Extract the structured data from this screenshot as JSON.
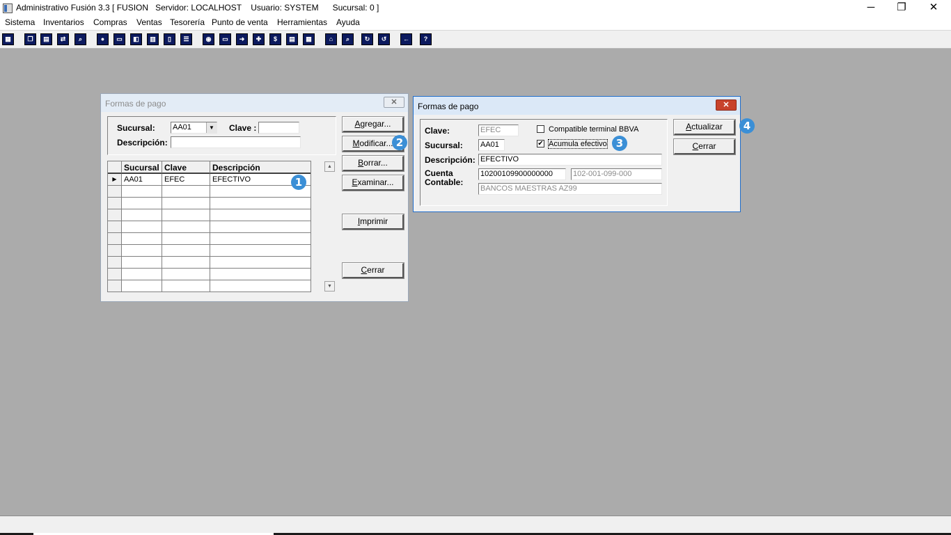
{
  "window": {
    "title": "Administrativo Fusión 3.3 [ FUSION   Servidor: LOCALHOST    Usuario: SYSTEM      Sucursal: 0 ]",
    "minimize_icon": "minimize-icon",
    "restore_icon": "restore-icon",
    "close_icon": "close-icon"
  },
  "menu": [
    "Sistema",
    "Inventarios",
    "Compras",
    "Ventas",
    "Tesorería",
    "Punto de venta",
    "Herramientas",
    "Ayuda"
  ],
  "toolbar": {
    "icons": [
      "calculator-icon",
      "copy-icon",
      "paste-icon",
      "swap-icon",
      "search-doc-icon",
      "user-icon",
      "folder-icon",
      "print-left-icon",
      "print-icon",
      "document-icon",
      "list-icon",
      "binoculars-icon",
      "folder-open-icon",
      "export-icon",
      "add-icon",
      "money-icon",
      "report-icon",
      "table-icon",
      "home-icon",
      "zoom-icon",
      "refresh-icon",
      "undo-icon",
      "back-arrow-icon",
      "help-icon"
    ],
    "help_glyph": "?"
  },
  "dialog_list": {
    "title": "Formas de pago",
    "close_glyph": "✕",
    "sucursal_label": "Sucursal:",
    "sucursal_value": "AA01",
    "clave_label": "Clave :",
    "clave_value": "",
    "descripcion_label": "Descripción:",
    "descripcion_value": "",
    "columns": [
      "Sucursal",
      "Clave",
      "Descripción"
    ],
    "rows": [
      {
        "sucursal": "AA01",
        "clave": "EFEC",
        "descripcion": "EFECTIVO"
      }
    ],
    "buttons": {
      "agregar": "Agregar...",
      "modificar": "Modificar...",
      "borrar": "Borrar...",
      "examinar": "Examinar...",
      "imprimir": "Imprimir",
      "cerrar": "Cerrar"
    }
  },
  "dialog_edit": {
    "title": "Formas de pago",
    "close_glyph": "✕",
    "clave_label": "Clave:",
    "clave_value": "EFEC",
    "sucursal_label": "Sucursal:",
    "sucursal_value": "AA01",
    "descripcion_label": "Descripción:",
    "descripcion_value": "EFECTIVO",
    "cuenta_label_1": "Cuenta",
    "cuenta_label_2": "Contable:",
    "cuenta_value": "10200109900000000",
    "cuenta_format": "102-001-099-000",
    "cuenta_nombre": "BANCOS MAESTRAS AZ99",
    "compatible_bbva_label": "Compatible terminal BBVA",
    "compatible_bbva_checked": false,
    "acumula_efectivo_label": "Acumula efectivo",
    "acumula_efectivo_checked": true,
    "check_glyph": "✔",
    "buttons": {
      "actualizar": "Actualizar",
      "cerrar": "Cerrar"
    }
  },
  "badges": [
    "1",
    "2",
    "3",
    "4"
  ],
  "badge_color": "#3b8fd6"
}
